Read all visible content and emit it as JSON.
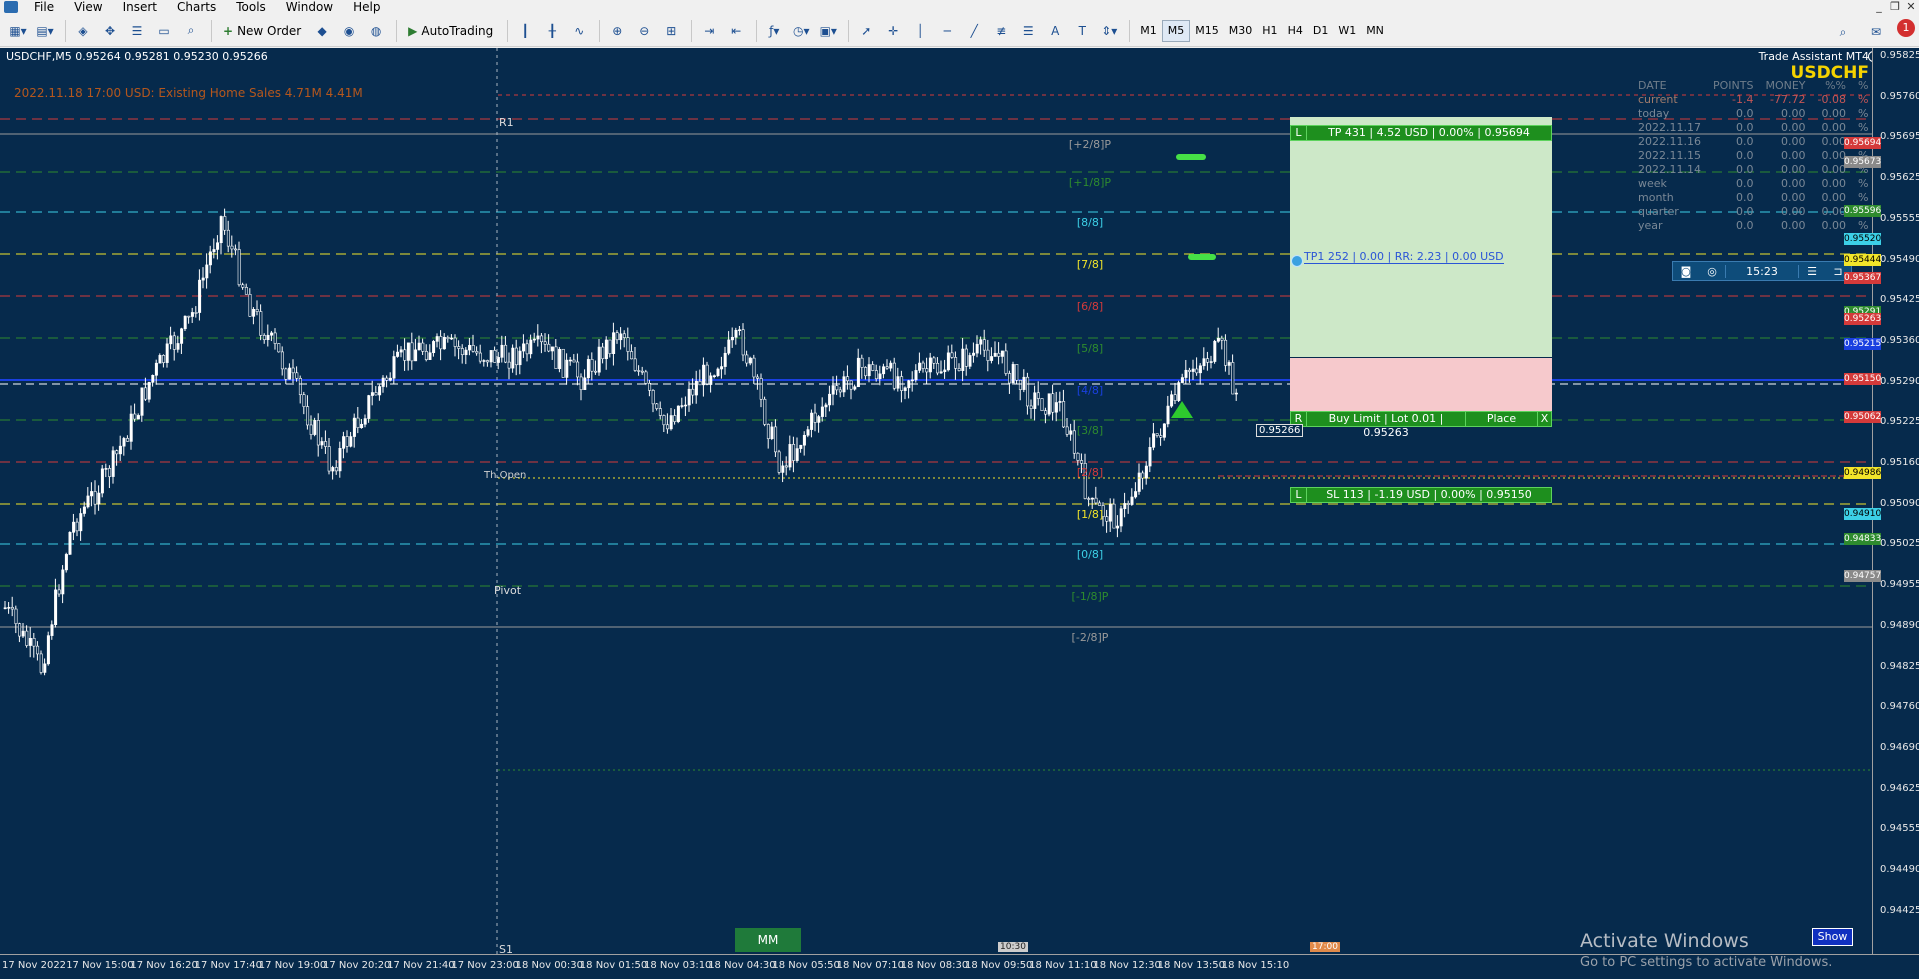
{
  "menu": [
    "File",
    "View",
    "Insert",
    "Charts",
    "Tools",
    "Window",
    "Help"
  ],
  "toolbar": {
    "new_order": "New Order",
    "autotrading": "AutoTrading",
    "timeframes": [
      "M1",
      "M5",
      "M15",
      "M30",
      "H1",
      "H4",
      "D1",
      "W1",
      "MN"
    ],
    "active_timeframe": "M5",
    "notifications": "1"
  },
  "chart": {
    "symbol_line": "USDCHF,M5  0.95264 0.95281 0.95230 0.95266",
    "news": "2022.11.18 17:00   USD: Existing Home Sales    4.71M    4.41M",
    "background": "#062a4c",
    "murrey": [
      {
        "label": "[+2/8]P",
        "color": "#9a9a9a"
      },
      {
        "label": "[+1/8]P",
        "color": "#2e8b2e"
      },
      {
        "label": "[8/8]",
        "color": "#3ccfe6"
      },
      {
        "label": "[7/8]",
        "color": "#f2e52a"
      },
      {
        "label": "[6/8]",
        "color": "#d43a3a"
      },
      {
        "label": "[5/8]",
        "color": "#2e8b2e"
      },
      {
        "label": "[4/8]",
        "color": "#1a40e0"
      },
      {
        "label": "[3/8]",
        "color": "#2e8b2e"
      },
      {
        "label": "[2/8]",
        "color": "#d43a3a"
      },
      {
        "label": "[1/8]",
        "color": "#f2e52a"
      },
      {
        "label": "[0/8]",
        "color": "#3ccfe6"
      },
      {
        "label": "[-1/8]P",
        "color": "#2e8b2e"
      },
      {
        "label": "[-2/8]P",
        "color": "#9a9a9a"
      }
    ],
    "pivot_labels": {
      "r1": "R1",
      "pivot": "Pivot",
      "s1": "S1",
      "today_open": "Th.Open"
    },
    "price_tags": [
      {
        "value": "0.95694",
        "color": "#d43a3a"
      },
      {
        "value": "0.95673",
        "color": "#8a8a8a"
      },
      {
        "value": "0.95596",
        "color": "#2e8b2e"
      },
      {
        "value": "0.95520",
        "color": "#3ccfe6"
      },
      {
        "value": "0.95444",
        "color": "#f2e52a"
      },
      {
        "value": "0.95367",
        "color": "#d43a3a"
      },
      {
        "value": "0.95291",
        "color": "#2e8b2e"
      },
      {
        "value": "0.95263",
        "color": "#d43a3a"
      },
      {
        "value": "0.95215",
        "color": "#1a40e0"
      },
      {
        "value": "0.95150",
        "color": "#d43a3a"
      },
      {
        "value": "0.95062",
        "color": "#d43a3a"
      },
      {
        "value": "0.94986",
        "color": "#f2e52a"
      },
      {
        "value": "0.94910",
        "color": "#3ccfe6"
      },
      {
        "value": "0.94833",
        "color": "#2e8b2e"
      },
      {
        "value": "0.94757",
        "color": "#8a8a8a"
      }
    ],
    "price_axis": [
      "0.95825",
      "0.95760",
      "0.95695",
      "0.95625",
      "0.95555",
      "0.95490",
      "0.95425",
      "0.95360",
      "0.95290",
      "0.95225",
      "0.95160",
      "0.95090",
      "0.95025",
      "0.94955",
      "0.94890",
      "0.94825",
      "0.94760",
      "0.94690",
      "0.94625",
      "0.94555",
      "0.94490",
      "0.94425"
    ],
    "time_axis": [
      "17 Nov 2022",
      "17 Nov 15:00",
      "17 Nov 16:20",
      "17 Nov 17:40",
      "17 Nov 19:00",
      "17 Nov 20:20",
      "17 Nov 21:40",
      "17 Nov 23:00",
      "18 Nov 00:30",
      "18 Nov 01:50",
      "18 Nov 03:10",
      "18 Nov 04:30",
      "18 Nov 05:50",
      "18 Nov 07:10",
      "18 Nov 08:30",
      "18 Nov 09:50",
      "18 Nov 11:10",
      "18 Nov 12:30",
      "18 Nov 13:50",
      "18 Nov 15:10"
    ],
    "time_badges": {
      "a": "10:30",
      "b": "17:00"
    }
  },
  "trade_assistant": {
    "title": "Trade Assistant MT4",
    "symbol": "USDCHF",
    "headers": [
      "DATE",
      "POINTS",
      "MONEY",
      "%%",
      "%"
    ],
    "rows": [
      {
        "date": "current",
        "points": "-1.4",
        "money": "-77.72",
        "pp": "-0.08",
        "p": "%"
      },
      {
        "date": "today",
        "points": "0.0",
        "money": "0.00",
        "pp": "0.00",
        "p": "%"
      },
      {
        "date": "2022.11.17",
        "points": "0.0",
        "money": "0.00",
        "pp": "0.00",
        "p": "%"
      },
      {
        "date": "2022.11.16",
        "points": "0.0",
        "money": "0.00",
        "pp": "0.00",
        "p": "%"
      },
      {
        "date": "2022.11.15",
        "points": "0.0",
        "money": "0.00",
        "pp": "0.00",
        "p": "%"
      },
      {
        "date": "2022.11.14",
        "points": "0.0",
        "money": "0.00",
        "pp": "0.00",
        "p": "%"
      },
      {
        "date": "week",
        "points": "0.0",
        "money": "0.00",
        "pp": "0.00",
        "p": "%"
      },
      {
        "date": "month",
        "points": "0.0",
        "money": "0.00",
        "pp": "0.00",
        "p": "%"
      },
      {
        "date": "quarter",
        "points": "0.0",
        "money": "0.00",
        "pp": "0.00",
        "p": "%"
      },
      {
        "date": "year",
        "points": "0.0",
        "money": "0.00",
        "pp": "0.00",
        "p": "%"
      }
    ],
    "clock": "15:23",
    "tp_bar": "TP 431 | 4.52 USD | 0.00% | 0.95694",
    "tp_tag": "L",
    "tp1_label": "TP1 252 | 0.00 | RR: 2.23 | 0.00 USD",
    "order_bar": "Buy Limit | Lot 0.01 | 0.95263",
    "order_tag": "R",
    "place": "Place",
    "close": "X",
    "sl_bar": "SL 113 | -1.19 USD | 0.00% | 0.95150",
    "sl_tag": "L",
    "entry_price": "0.95266",
    "mm": "MM",
    "show": "Show"
  },
  "watermark": {
    "title": "Activate Windows",
    "subtitle": "Go to PC settings to activate Windows."
  }
}
